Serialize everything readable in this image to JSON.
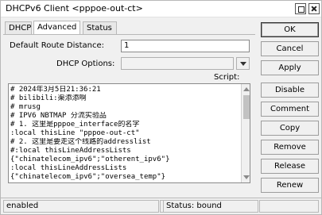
{
  "window": {
    "title": "DHCPv6 Client <pppoe-out-ct>"
  },
  "tabs": [
    {
      "label": "DHCP"
    },
    {
      "label": "Advanced"
    },
    {
      "label": "Status"
    }
  ],
  "form": {
    "route_distance_label": "Default Route Distance:",
    "route_distance_value": "1",
    "dhcp_options_label": "DHCP Options:",
    "dhcp_options_value": "",
    "script_label": "Script:"
  },
  "script": {
    "lines": [
      "# 2024年3月5日21:36:21",
      "# bilibili:渠添添啊",
      "# mrusg",
      "# IPV6 NBTMAP 分流实验品",
      "# 1. 这里是pppoe_interface的名字",
      ":local thisLine \"pppoe-out-ct\"",
      "# 2. 这里是要走这个线路的addresslist",
      "#:local thisLineAddressLists",
      "{\"chinatelecom_ipv6\";\"otherent_ipv6\"}",
      ":local thisLineAddressLists",
      "{\"chinatelecom_ipv6\";\"oversea_temp\"}"
    ]
  },
  "buttons": {
    "ok": "OK",
    "cancel": "Cancel",
    "apply": "Apply",
    "disable": "Disable",
    "comment": "Comment",
    "copy": "Copy",
    "remove": "Remove",
    "release": "Release",
    "renew": "Renew"
  },
  "statusbar": {
    "enabled": "enabled",
    "status": "Status: bound"
  }
}
